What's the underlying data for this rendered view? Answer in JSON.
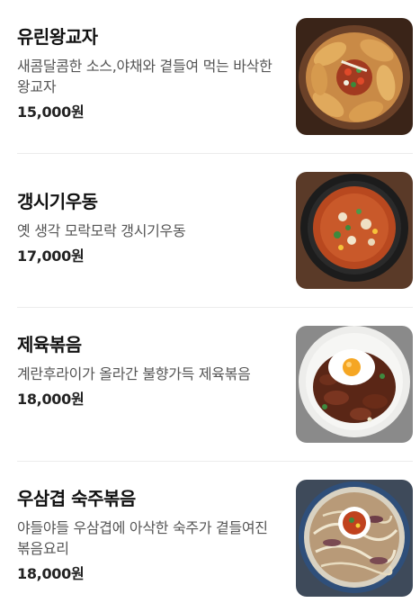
{
  "menu": {
    "items": [
      {
        "name": "유린왕교자",
        "description": "새콤달콤한 소스,야채와 곁들여 먹는 바삭한 왕교자",
        "price": "15,000원",
        "photo_icon": "fried-dumplings-photo"
      },
      {
        "name": "갱시기우동",
        "description": "옛 생각 모락모락 갱시기우동",
        "price": "17,000원",
        "photo_icon": "udon-soup-photo"
      },
      {
        "name": "제육볶음",
        "description": "계란후라이가 올라간 불향가득 제육볶음",
        "price": "18,000원",
        "photo_icon": "spicy-pork-photo"
      },
      {
        "name": "우삼겹 숙주볶음",
        "description": "야들야들 우삼겹에 아삭한 숙주가 곁들여진 볶음요리",
        "price": "18,000원",
        "photo_icon": "beef-sprouts-photo"
      }
    ]
  }
}
